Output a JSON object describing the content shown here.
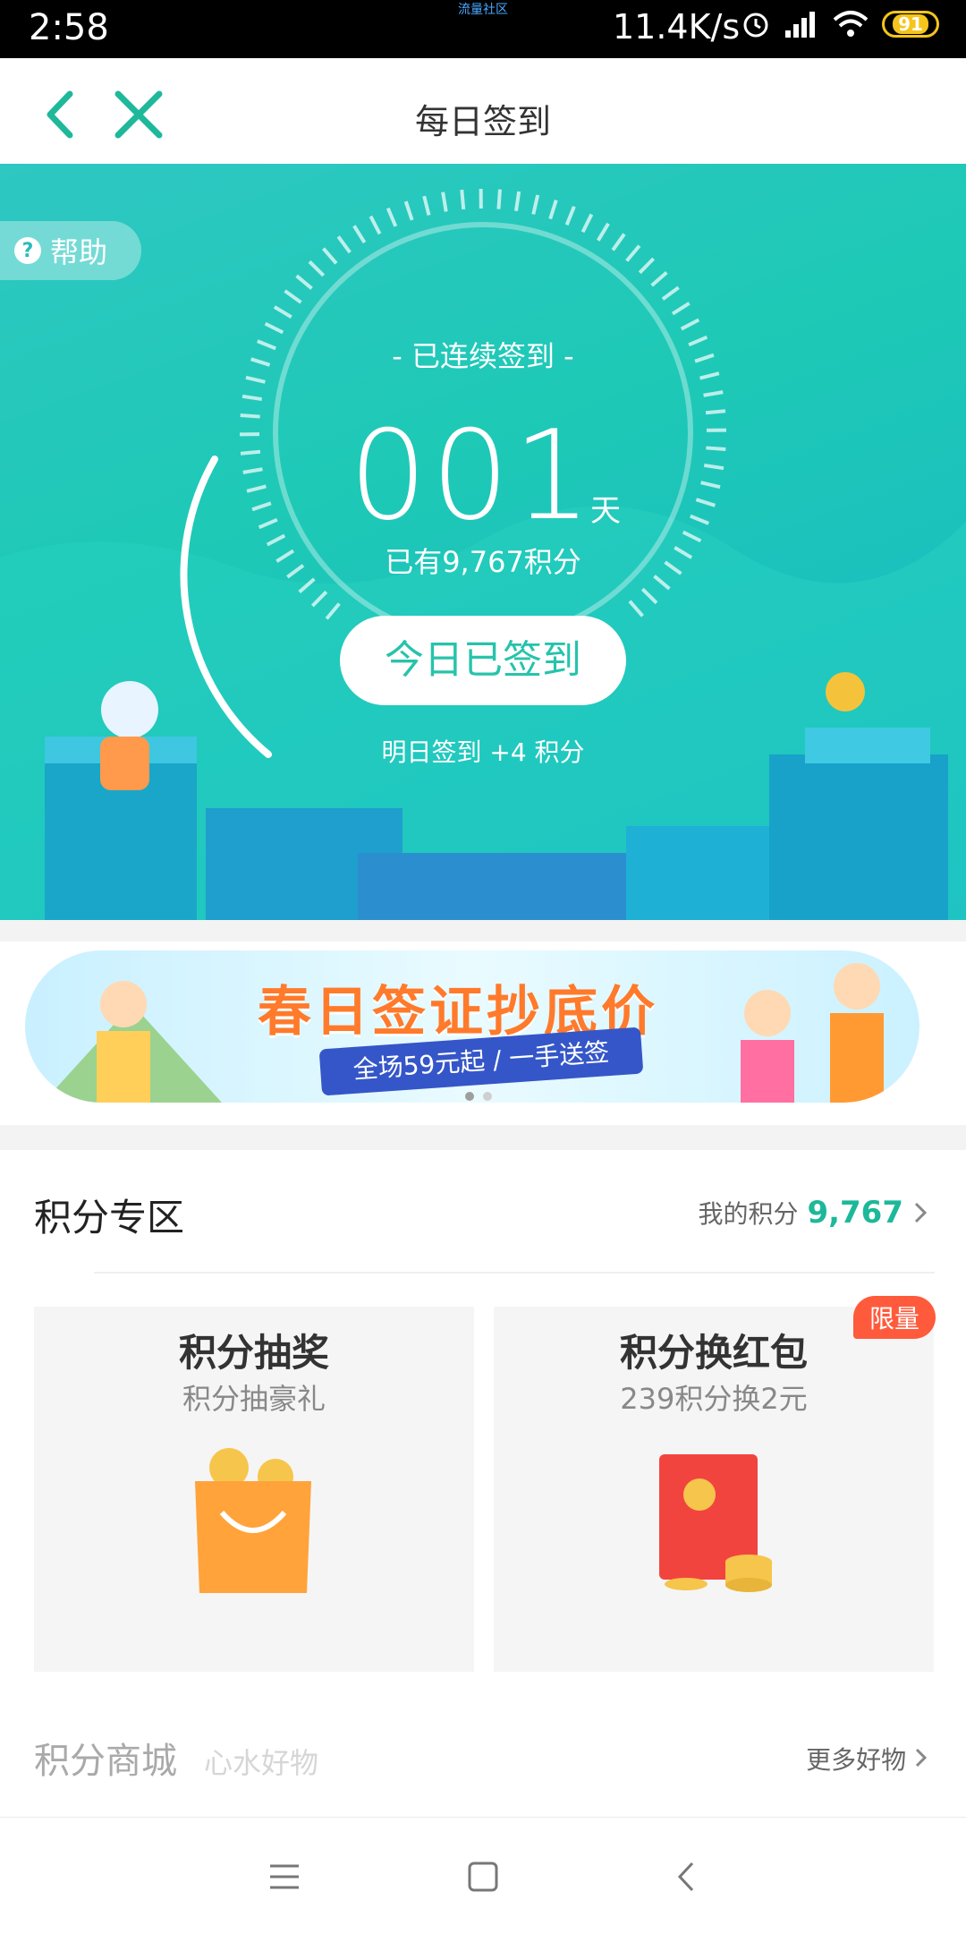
{
  "status_bar": {
    "time": "2:58",
    "center_text": "流量社区",
    "net_speed": "11.4K/s",
    "battery": "91"
  },
  "header": {
    "title": "每日签到"
  },
  "hero": {
    "help_label": "帮助",
    "consecutive_label": "- 已连续签到 -",
    "days": "001",
    "days_unit": "天",
    "points_text": "已有9,767积分",
    "signed_button": "今日已签到",
    "tomorrow_text": "明日签到 +4 积分"
  },
  "banner": {
    "headline": "春日签证抄底价",
    "ribbon": "全场59元起 / 一手送签"
  },
  "points_zone": {
    "title": "积分专区",
    "my_points_label": "我的积分",
    "my_points_value": "9,767",
    "cards": [
      {
        "title": "积分抽奖",
        "subtitle": "积分抽豪礼"
      },
      {
        "title": "积分换红包",
        "subtitle": "239积分换2元",
        "badge": "限量"
      }
    ]
  },
  "mall": {
    "title": "积分商城",
    "subtitle": "心水好物",
    "more": "更多好物"
  },
  "colors": {
    "accent": "#1db89a",
    "hero": "#1ec9b6",
    "badge": "#ff5a3c"
  }
}
